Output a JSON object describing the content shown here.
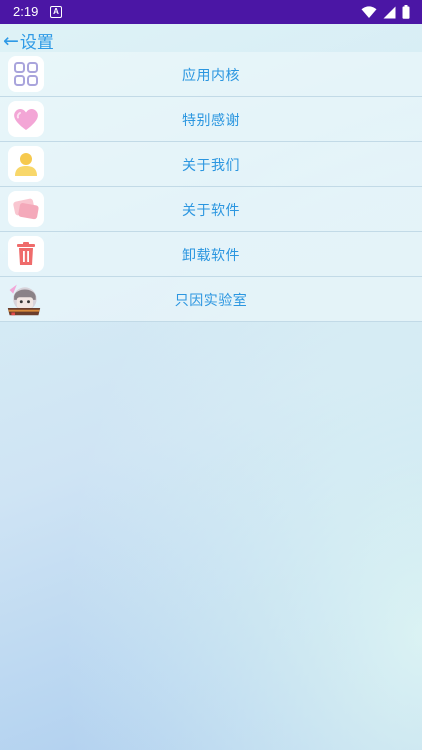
{
  "status_bar": {
    "time": "2:19",
    "notification_letter": "A",
    "icons": [
      "wifi-icon",
      "cellular-signal-icon",
      "battery-icon"
    ]
  },
  "header": {
    "back_arrow": "←",
    "title": "设置"
  },
  "menu": {
    "items": [
      {
        "label": "应用内核",
        "icon": "grid-icon"
      },
      {
        "label": "特别感谢",
        "icon": "heart-icon"
      },
      {
        "label": "关于我们",
        "icon": "person-icon"
      },
      {
        "label": "关于软件",
        "icon": "stacked-cards-icon"
      },
      {
        "label": "卸载软件",
        "icon": "trash-icon"
      },
      {
        "label": "只因实验室",
        "icon": "lab-avatar-icon"
      }
    ]
  },
  "colors": {
    "status_bar": "#4b16a5",
    "accent_text": "#2b96e0",
    "divider": "#bed7e4"
  }
}
